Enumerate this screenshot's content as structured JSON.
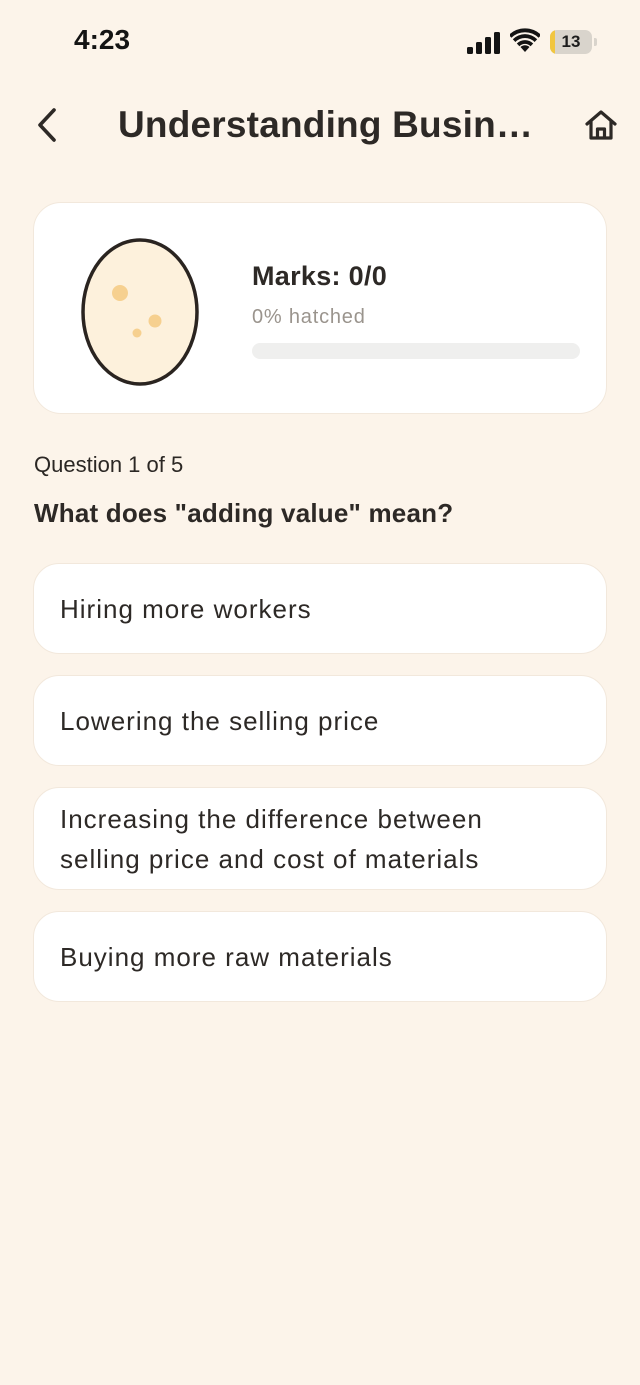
{
  "status_bar": {
    "time": "4:23",
    "battery_level": "13",
    "battery_fraction": 0.13
  },
  "header": {
    "title": "Understanding Busin…",
    "back_icon": "chevron-left-icon",
    "home_icon": "home-icon"
  },
  "progress_card": {
    "marks": "Marks: 0/0",
    "hatched": "0% hatched",
    "hatched_fraction": 0,
    "egg_icon": "egg-icon"
  },
  "question": {
    "counter": "Question 1 of 5",
    "text": "What does \"adding value\" mean?"
  },
  "options": [
    {
      "label": "Hiring more workers"
    },
    {
      "label": "Lowering the selling price"
    },
    {
      "label": "Increasing the difference between selling price and cost of materials"
    },
    {
      "label": "Buying more raw materials"
    }
  ],
  "colors": {
    "background": "#fcf4ea",
    "card": "#ffffff",
    "text": "#2d2926",
    "muted": "#9a948d",
    "egg_fill": "#fdf1dc",
    "egg_spots": "#f6d08f",
    "battery_fill": "#f1c640"
  }
}
